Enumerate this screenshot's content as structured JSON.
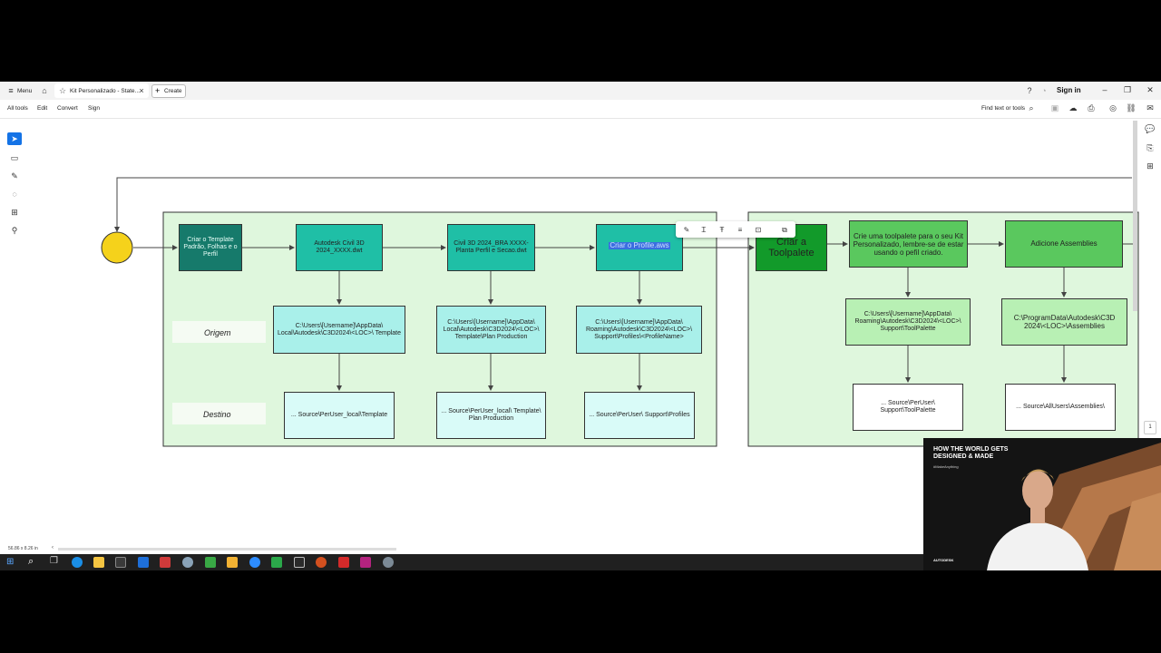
{
  "titlebar": {
    "menu_label": "Menu",
    "tab_title": "Kit Personalizado - State...",
    "create_label": "Create",
    "sign_in": "Sign in"
  },
  "toolbar": {
    "all_tools": "All tools",
    "edit": "Edit",
    "convert": "Convert",
    "sign": "Sign",
    "find_placeholder": "Find text or tools"
  },
  "diagram": {
    "nodes": {
      "template": "Criar o Template Padrão, Folhas e o Perfil",
      "dwt1": "Autodesk Civil 3D 2024_XXXX.dwt",
      "dwt2": "Civil 3D 2024_BRA XXXX-Planta Perfil e Secao.dwt",
      "profile": "Criar o Profile.aws",
      "toolpalete": "Criar a Toolpalete",
      "create_tp": "Crie uma toolpalete para o seu Kit Personalizado, lembre-se de estar usando o pefil criado.",
      "assemblies": "Adicione Assemblies",
      "origin1": "C:\\Users\\[Username]\\AppData\\ Local\\Autodesk\\C3D2024\\<LOC>\\ Template",
      "origin2": "C:\\Users\\[Username]\\AppData\\ Local\\Autodesk\\C3D2024\\<LOC>\\ Template\\Plan Production",
      "origin3": "C:\\Users\\[Username]\\AppData\\ Roaming\\Autodesk\\C3D2024\\<LOC>\\ Support\\Profiles\\<ProfileName>",
      "origin4": "C:\\Users\\[Username]\\AppData\\ Roaming\\Autodesk\\C3D2024\\<LOC>\\ Support\\ToolPalette",
      "origin5": "C:\\ProgramData\\Autodesk\\C3D 2024\\<LOC>\\Assemblies",
      "dest1": "... Source\\PerUser_local\\Template",
      "dest2": "... Source\\PerUser_local\\ Template\\ Plan Production",
      "dest3": "... Source\\PerUser\\ Support\\Profiles",
      "dest4": "... Source\\PerUser\\ Support\\ToolPalette",
      "dest5": "... Source\\AllUsers\\Assemblies\\"
    },
    "row_labels": {
      "origem": "Origem",
      "destino": "Destino"
    }
  },
  "status": {
    "size": "56.86 x 8.26 in",
    "page_num": "1"
  },
  "video": {
    "headline_1": "HOW THE WORLD GETS",
    "headline_2": "DESIGNED & MADE",
    "hashtag": "#MakeAnything",
    "brand": "AUTODESK"
  },
  "colors": {
    "group_fill": "#dff7dd",
    "dark_teal": "#167a6b",
    "teal": "#1fbfa6",
    "light_cyan": "#a9f0ea",
    "dark_green": "#129a2a",
    "green": "#5ac85e",
    "light_green": "#b8f0b4",
    "start_circle": "#f5d21b"
  }
}
